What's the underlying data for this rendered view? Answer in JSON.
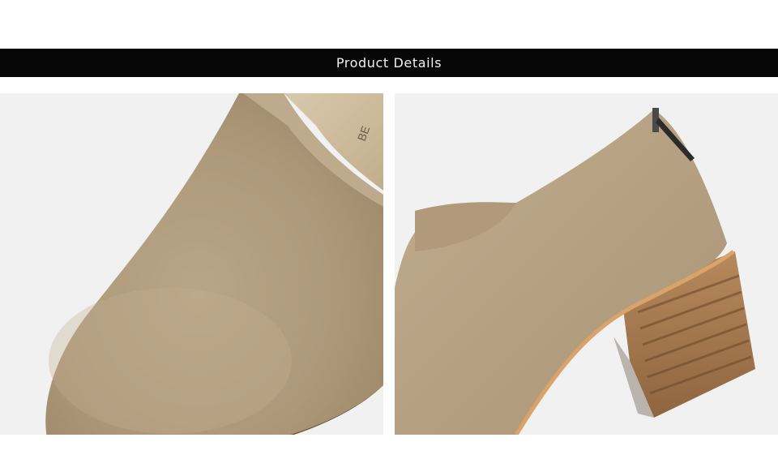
{
  "banner": {
    "title": "Product Details"
  },
  "photos": [
    {
      "subject": "shoe-toe-closeup"
    },
    {
      "subject": "shoe-heel-closeup"
    }
  ],
  "colors": {
    "banner_bg": "#070707",
    "banner_text": "#f2f2f2",
    "suede": "#b6a183",
    "sole": "#7a5a3a",
    "heel_wood": "#a87a4d",
    "background": "#f1f1f1"
  }
}
